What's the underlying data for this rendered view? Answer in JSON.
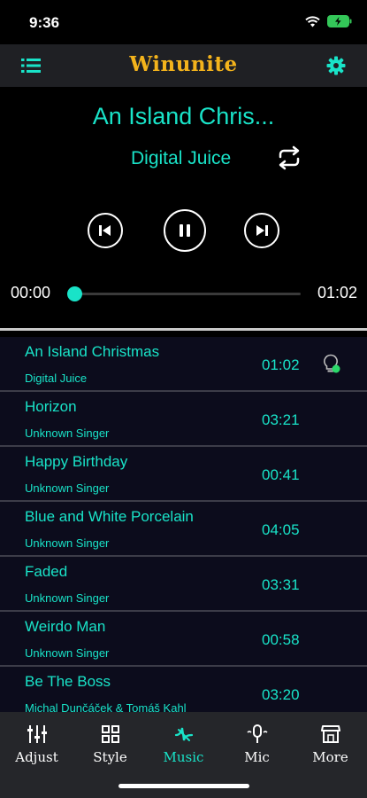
{
  "status_bar": {
    "time": "9:36"
  },
  "app": {
    "title": "Winunite",
    "accent": "#19e3c8",
    "title_color": "#f3b31c"
  },
  "now_playing": {
    "title": "An Island Chris...",
    "artist": "Digital Juice",
    "current_time": "00:00",
    "total_time": "01:02",
    "progress": 0.0
  },
  "songs": [
    {
      "title": "An Island Christmas",
      "artist": "Digital Juice",
      "duration": "01:02",
      "icon": "lightbulb-icon"
    },
    {
      "title": "Horizon",
      "artist": "Unknown Singer",
      "duration": "03:21"
    },
    {
      "title": "Happy Birthday",
      "artist": "Unknown Singer",
      "duration": "00:41"
    },
    {
      "title": "Blue and White Porcelain",
      "artist": "Unknown Singer",
      "duration": "04:05"
    },
    {
      "title": "Faded",
      "artist": "Unknown Singer",
      "duration": "03:31"
    },
    {
      "title": "Weirdo Man",
      "artist": "Unknown Singer",
      "duration": "00:58"
    },
    {
      "title": "Be The Boss",
      "artist": "Michal Dunčáček & Tomáš Kahl",
      "duration": "03:20"
    }
  ],
  "tabs": [
    {
      "label": "Adjust",
      "icon": "sliders-icon"
    },
    {
      "label": "Style",
      "icon": "grid-icon"
    },
    {
      "label": "Music",
      "icon": "music-icon",
      "active": true
    },
    {
      "label": "Mic",
      "icon": "mic-icon"
    },
    {
      "label": "More",
      "icon": "store-icon"
    }
  ]
}
